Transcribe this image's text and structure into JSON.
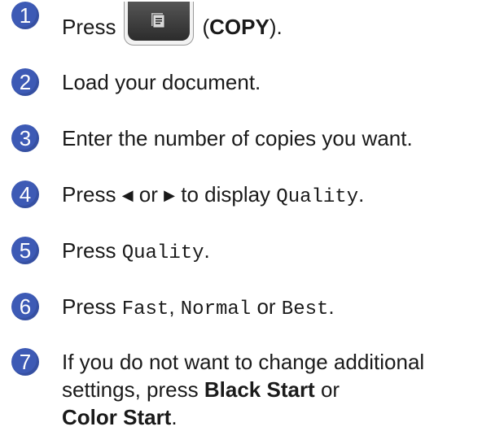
{
  "colors": {
    "step_badge": "#3d5ab5",
    "text": "#1a1a1a"
  },
  "steps": [
    {
      "number": "1",
      "press": "Press",
      "key_icon": "copy-icon",
      "key_label_open": "(",
      "key_label": "COPY",
      "key_label_close": ")."
    },
    {
      "number": "2",
      "text": "Load your document."
    },
    {
      "number": "3",
      "text": "Enter the number of copies you want."
    },
    {
      "number": "4",
      "press": "Press",
      "left_arrow": "◀",
      "or": "or",
      "right_arrow": "▶",
      "to_display": "to display",
      "option": "Quality",
      "end": "."
    },
    {
      "number": "5",
      "press": "Press",
      "option": "Quality",
      "end": "."
    },
    {
      "number": "6",
      "press": "Press",
      "opt1": "Fast",
      "sep1": ",",
      "opt2": "Normal",
      "or": "or",
      "opt3": "Best",
      "end": "."
    },
    {
      "number": "7",
      "line1": "If you do not want to change additional",
      "line2_pre": "settings, press",
      "black_start": "Black Start",
      "line2_or": "or",
      "color_start": "Color Start",
      "end": "."
    }
  ]
}
